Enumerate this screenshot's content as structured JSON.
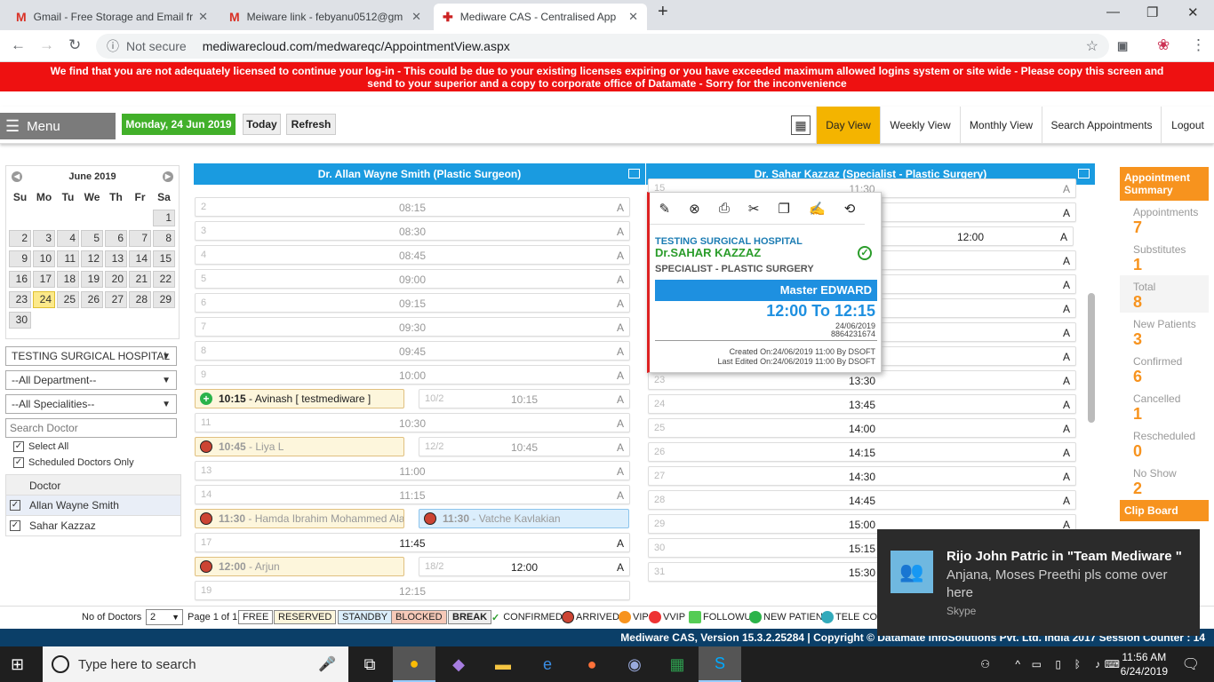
{
  "browser": {
    "tabs": [
      {
        "icon": "M",
        "title": "Gmail - Free Storage and Email fr"
      },
      {
        "icon": "M",
        "title": "Meiware link - febyanu0512@gm"
      },
      {
        "icon": "✚",
        "title": "Mediware CAS - Centralised App"
      }
    ],
    "new_tab": "+",
    "security": "Not secure",
    "url": "mediwarecloud.com/medwareqc/AppointmentView.aspx"
  },
  "banner": {
    "line1": "We find that you are not adequately licensed to continue your log-in - This could be due to your existing licenses expiring or you have exceeded maximum allowed logins system or site wide - Please copy this screen and",
    "line2": "send to your superior and a copy to corporate office of Datamate - Sorry for the inconvenience"
  },
  "toolbar": {
    "menu_label": "Menu",
    "date_label": "Monday, 24 Jun 2019",
    "today_label": "Today",
    "refresh_label": "Refresh",
    "day_view": "Day View",
    "weekly_view": "Weekly View",
    "monthly_view": "Monthly View",
    "search_appointments": "Search Appointments",
    "logout": "Logout"
  },
  "calendar": {
    "month": "June 2019",
    "weekdays": [
      "Su",
      "Mo",
      "Tu",
      "We",
      "Th",
      "Fr",
      "Sa"
    ],
    "days": [
      "",
      "",
      "",
      "",
      "",
      "",
      "1",
      "2",
      "3",
      "4",
      "5",
      "6",
      "7",
      "8",
      "9",
      "10",
      "11",
      "12",
      "13",
      "14",
      "15",
      "16",
      "17",
      "18",
      "19",
      "20",
      "21",
      "22",
      "23",
      "24",
      "25",
      "26",
      "27",
      "28",
      "29",
      "30"
    ],
    "today": "24"
  },
  "filters": {
    "hospital": "TESTING SURGICAL HOSPITAL",
    "department": "--All Department--",
    "speciality": "--All Specialities--",
    "search_placeholder": "Search Doctor",
    "select_all": "Select All",
    "scheduled_only": "Scheduled Doctors Only"
  },
  "doctor_list": {
    "header": "Doctor",
    "doctors": [
      "Allan Wayne Smith",
      "Sahar Kazzaz"
    ]
  },
  "columns": [
    {
      "title": "Dr. Allan Wayne Smith (Plastic Surgeon)",
      "slots": [
        {
          "n": "2",
          "t": "08:15",
          "a": "A"
        },
        {
          "n": "3",
          "t": "08:30",
          "a": "A"
        },
        {
          "n": "4",
          "t": "08:45",
          "a": "A"
        },
        {
          "n": "5",
          "t": "09:00",
          "a": "A"
        },
        {
          "n": "6",
          "t": "09:15",
          "a": "A"
        },
        {
          "n": "7",
          "t": "09:30",
          "a": "A"
        },
        {
          "n": "8",
          "t": "09:45",
          "a": "A"
        },
        {
          "n": "9",
          "t": "10:00",
          "a": "A"
        },
        {
          "n": "10/2",
          "t": "10:15",
          "a": "A"
        },
        {
          "n": "11",
          "t": "10:30",
          "a": "A"
        },
        {
          "n": "12/2",
          "t": "10:45",
          "a": "A"
        },
        {
          "n": "13",
          "t": "11:00",
          "a": "A"
        },
        {
          "n": "14",
          "t": "11:15",
          "a": "A"
        },
        {
          "n": "",
          "t": "",
          "a": ""
        },
        {
          "n": "17",
          "t": "11:45",
          "a": "A"
        },
        {
          "n": "18/2",
          "t": "12:00",
          "a": "A"
        },
        {
          "n": "19",
          "t": "12:15",
          "a": ""
        }
      ],
      "appointments": [
        {
          "time": "10:15",
          "name": "Avinash [ testmediware ]"
        },
        {
          "time": "10:45",
          "name": "Liya L"
        },
        {
          "time": "11:30",
          "name": "Hamda Ibrahim Mohammed Ala"
        },
        {
          "time": "11:30",
          "name": "Vatche Kavlakian"
        },
        {
          "time": "12:00",
          "name": "Arjun"
        }
      ]
    },
    {
      "title": "Dr. Sahar Kazzaz (Specialist - Plastic Surgery)",
      "slots": [
        {
          "n": "15",
          "t": "11:30",
          "a": "A"
        },
        {
          "n": "",
          "t": "11:45",
          "a": "A"
        },
        {
          "n": "/2",
          "t": "12:00",
          "a": "A"
        },
        {
          "n": "",
          "t": "",
          "a": "A"
        },
        {
          "n": "",
          "t": "",
          "a": "A"
        },
        {
          "n": "",
          "t": "",
          "a": "A"
        },
        {
          "n": "",
          "t": "",
          "a": "A"
        },
        {
          "n": "",
          "t": "",
          "a": "A"
        },
        {
          "n": "23",
          "t": "13:30",
          "a": "A"
        },
        {
          "n": "24",
          "t": "13:45",
          "a": "A"
        },
        {
          "n": "25",
          "t": "14:00",
          "a": "A"
        },
        {
          "n": "26",
          "t": "14:15",
          "a": "A"
        },
        {
          "n": "27",
          "t": "14:30",
          "a": "A"
        },
        {
          "n": "28",
          "t": "14:45",
          "a": "A"
        },
        {
          "n": "29",
          "t": "15:00",
          "a": "A"
        },
        {
          "n": "30",
          "t": "15:15",
          "a": "A"
        },
        {
          "n": "31",
          "t": "15:30",
          "a": "A"
        }
      ]
    }
  ],
  "popup": {
    "hospital": "TESTING SURGICAL HOSPITAL",
    "doctor": "Dr.SAHAR KAZZAZ",
    "speciality": "SPECIALIST - PLASTIC SURGERY",
    "patient": "Master EDWARD",
    "time": "12:00 To 12:15",
    "date": "24/06/2019",
    "phone": "8864231674",
    "created": "Created On:24/06/2019 11:00 By DSOFT",
    "edited": "Last Edited On:24/06/2019 11:00 By DSOFT"
  },
  "summary": {
    "title": "Appointment Summary",
    "items": [
      {
        "label": "Appointments",
        "value": "7"
      },
      {
        "label": "Substitutes",
        "value": "1"
      },
      {
        "label": "Total",
        "value": "8"
      },
      {
        "label": "New Patients",
        "value": "3"
      },
      {
        "label": "Confirmed",
        "value": "6"
      },
      {
        "label": "Cancelled",
        "value": "1"
      },
      {
        "label": "Rescheduled",
        "value": "0"
      },
      {
        "label": "No Show",
        "value": "2"
      }
    ],
    "clipboard": "Clip Board"
  },
  "legend": {
    "no_of_doctors_label": "No of Doctors",
    "no_of_doctors": "2",
    "page": "Page 1 of 1",
    "free": "FREE",
    "reserved": "RESERVED",
    "standby": "STANDBY",
    "blocked": "BLOCKED",
    "break": "BREAK",
    "confirmed": "CONFIRMED",
    "arrived": "ARRIVED",
    "vip": "VIP",
    "vvip": "VVIP",
    "followup": "FOLLOWUP",
    "new_patient": "NEW PATIENT",
    "tele": "TELE CO"
  },
  "footer": "Mediware CAS, Version 15.3.2.25284 | Copyright © Datamate InfoSolutions Pvt. Ltd. India 2017 Session Counter : 14",
  "toast": {
    "title": "Rijo John Patric in \"Team Mediware \"",
    "message": "Anjana, Moses Preethi pls come over here",
    "app": "Skype"
  },
  "taskbar": {
    "search_placeholder": "Type here to search",
    "time": "11:56 AM",
    "date": "6/24/2019"
  },
  "colors": {
    "banner": "#ee1111",
    "accent": "#1a9be0",
    "summary": "#f7931e",
    "green": "#42b02a"
  }
}
